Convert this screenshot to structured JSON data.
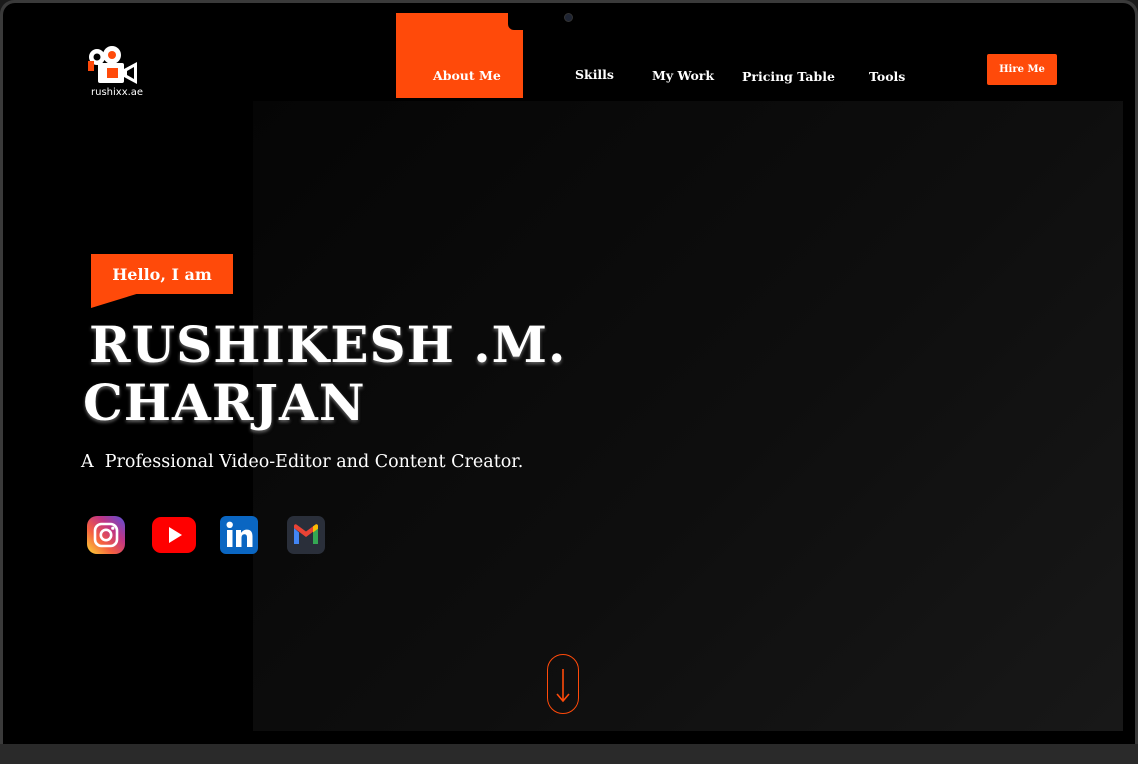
{
  "logo": {
    "text": "rushixx.ae"
  },
  "nav": {
    "about": "About Me",
    "skills": "Skills",
    "work": "My Work",
    "pricing": "Pricing Table",
    "tools": "Tools",
    "hire": "Hire Me"
  },
  "hero": {
    "greeting": "Hello, I am",
    "name_line1": "RUSHIKESH .M.",
    "name_line2": "CHARJAN",
    "tagline": "A  Professional Video-Editor and Content Creator."
  },
  "social": [
    "instagram-icon",
    "youtube-icon",
    "linkedin-icon",
    "gmail-icon"
  ],
  "colors": {
    "accent": "#ff4a0a",
    "background": "#000000",
    "text": "#ffffff"
  }
}
